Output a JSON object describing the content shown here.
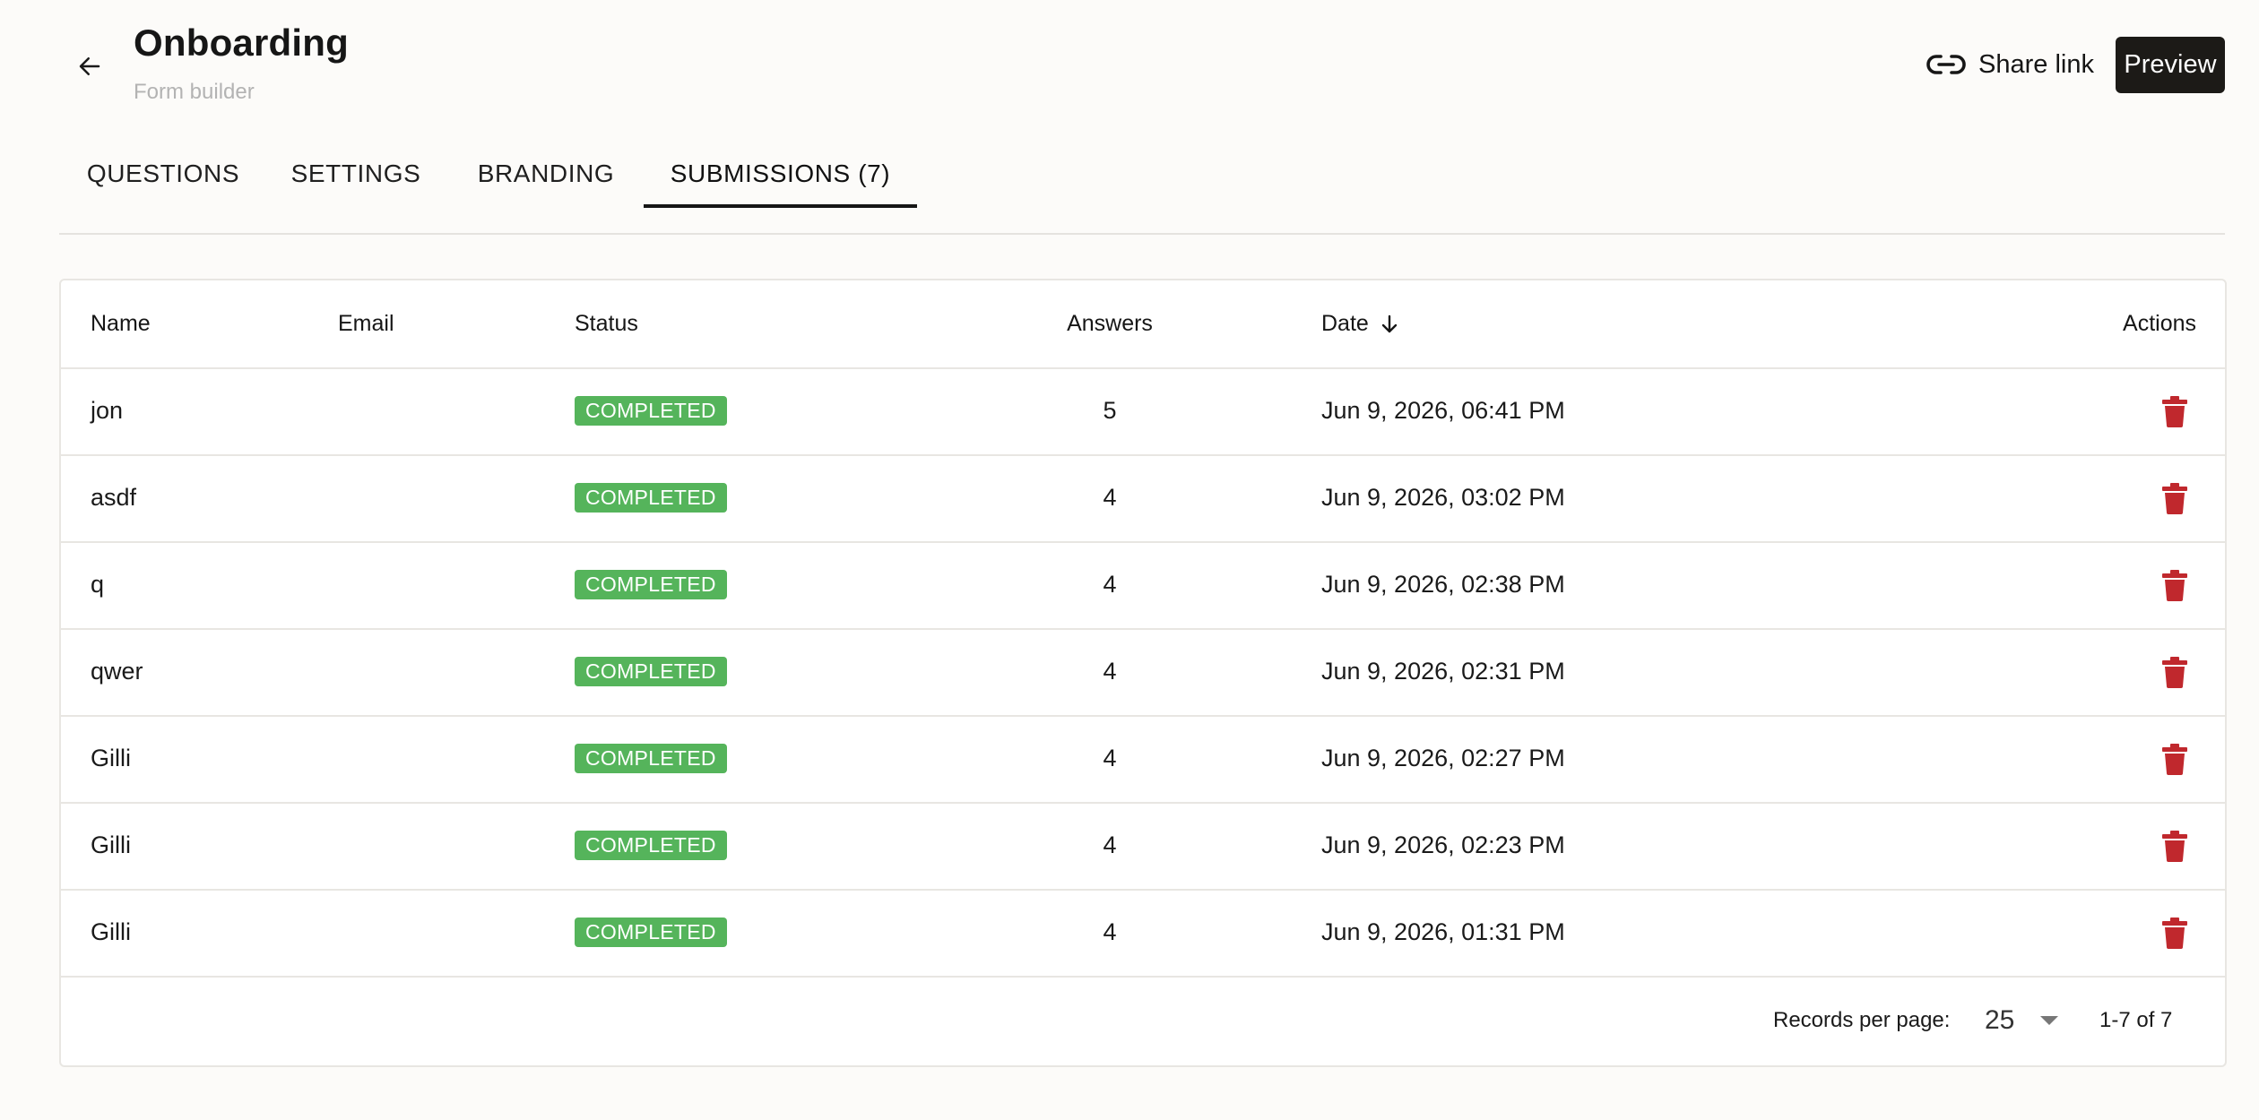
{
  "header": {
    "title": "Onboarding",
    "subtitle": "Form builder",
    "share_label": "Share link",
    "preview_label": "Preview"
  },
  "tabs": [
    {
      "label": "QUESTIONS",
      "active": false
    },
    {
      "label": "SETTINGS",
      "active": false
    },
    {
      "label": "BRANDING",
      "active": false
    },
    {
      "label": "SUBMISSIONS (7)",
      "active": true
    }
  ],
  "table": {
    "columns": {
      "name": "Name",
      "email": "Email",
      "status": "Status",
      "answers": "Answers",
      "date": "Date",
      "actions": "Actions"
    },
    "rows": [
      {
        "name": "jon",
        "email": "",
        "status": "COMPLETED",
        "answers": "5",
        "date": "Jun 9, 2026, 06:41 PM"
      },
      {
        "name": "asdf",
        "email": "",
        "status": "COMPLETED",
        "answers": "4",
        "date": "Jun 9, 2026, 03:02 PM"
      },
      {
        "name": "q",
        "email": "",
        "status": "COMPLETED",
        "answers": "4",
        "date": "Jun 9, 2026, 02:38 PM"
      },
      {
        "name": "qwer",
        "email": "",
        "status": "COMPLETED",
        "answers": "4",
        "date": "Jun 9, 2026, 02:31 PM"
      },
      {
        "name": "Gilli",
        "email": "",
        "status": "COMPLETED",
        "answers": "4",
        "date": "Jun 9, 2026, 02:27 PM"
      },
      {
        "name": "Gilli",
        "email": "",
        "status": "COMPLETED",
        "answers": "4",
        "date": "Jun 9, 2026, 02:23 PM"
      },
      {
        "name": "Gilli",
        "email": "",
        "status": "COMPLETED",
        "answers": "4",
        "date": "Jun 9, 2026, 01:31 PM"
      }
    ]
  },
  "pagination": {
    "records_label": "Records per page:",
    "per_page": "25",
    "range": "1-7 of 7"
  },
  "colors": {
    "status_completed": "#55b45b",
    "delete_icon": "#c0282d",
    "primary_button": "#1c1a17"
  },
  "icons": {
    "back": "arrow-left-icon",
    "share": "link-icon",
    "sort": "arrow-down-icon",
    "delete": "trash-icon",
    "select": "caret-down-icon"
  }
}
